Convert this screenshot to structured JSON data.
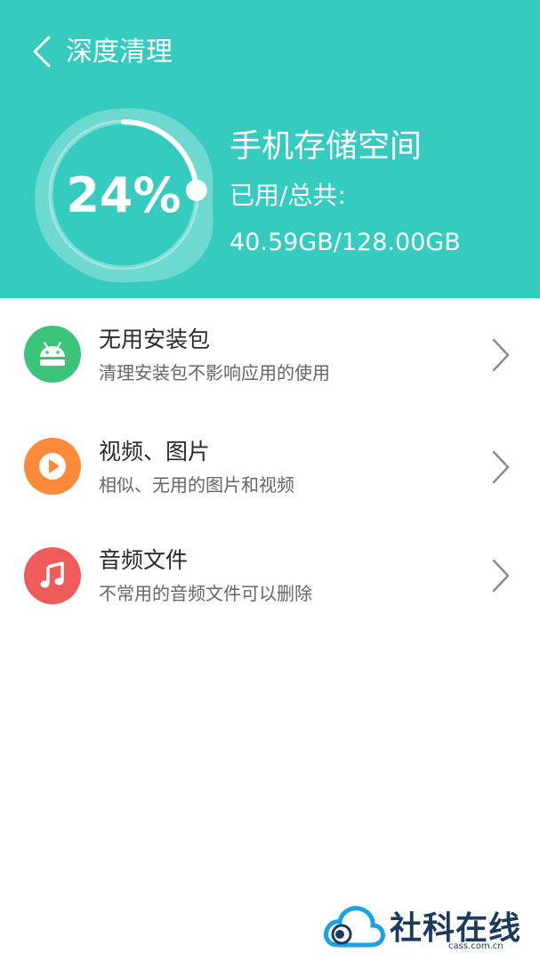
{
  "header": {
    "title": "深度清理",
    "background": "#35cbbf"
  },
  "storage": {
    "percent_text": "24%",
    "percent_value": 24,
    "title": "手机存储空间",
    "used_total_label": "已用/总共:",
    "used_total_value": "40.59GB/128.00GB"
  },
  "items": [
    {
      "title": "无用安装包",
      "subtitle": "清理安装包不影响应用的使用",
      "icon": "android-icon",
      "color": "#3cc37a"
    },
    {
      "title": "视频、图片",
      "subtitle": "相似、无用的图片和视频",
      "icon": "play-icon",
      "color": "#ff8a3a"
    },
    {
      "title": "音频文件",
      "subtitle": "不常用的音频文件可以删除",
      "icon": "music-note-icon",
      "color": "#ef5a5a"
    }
  ],
  "watermark": {
    "text": "社科在线",
    "url": "cass.com.cn"
  }
}
